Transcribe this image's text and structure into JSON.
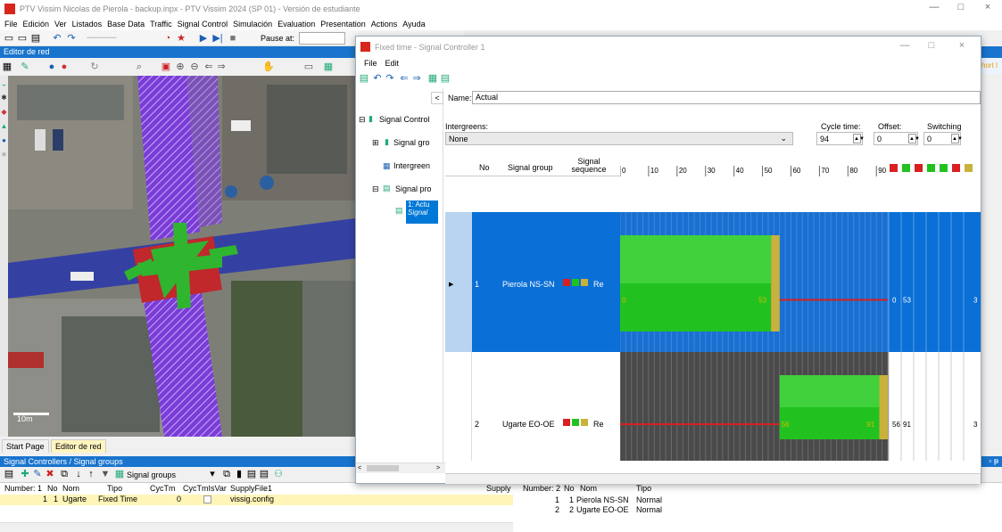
{
  "window": {
    "title": "PTV Vissim Nicolas de Pierola - backup.inpx - PTV Vissim 2024 (SP 01) - Versión de estudiante",
    "minimize": "—",
    "maximize": "□",
    "close": "×"
  },
  "menu": [
    "File",
    "Edición",
    "Ver",
    "Listados",
    "Base Data",
    "Traffic",
    "Signal Control",
    "Simulación",
    "Evaluation",
    "Presentation",
    "Actions",
    "Ayuda"
  ],
  "toolbar": {
    "pause_label": "Pause at:"
  },
  "network_editor": {
    "header": "Editor de red",
    "scale_label": "10m"
  },
  "right_strip": {
    "short_label": "hort I"
  },
  "tabs": {
    "start_page": "Start Page",
    "network_editor": "Editor de red"
  },
  "signal_controllers_panel": {
    "header": "Signal Controllers / Signal groups",
    "dropdown": "Signal groups",
    "list1": {
      "headers": [
        "Number: 1",
        "No",
        "Nom",
        "Tipo",
        "CycTm",
        "CycTmIsVar",
        "SupplyFile1",
        "Supply"
      ],
      "rows": [
        {
          "no": "1",
          "name": "Ugarte",
          "type": "Fixed Time",
          "cyctm": "0",
          "supply": "vissig.config"
        }
      ]
    },
    "list2": {
      "headers": [
        "Number: 2",
        "No",
        "Nom",
        "Tipo"
      ],
      "rows": [
        {
          "idx": "1",
          "no": "1",
          "name": "Pierola NS-SN",
          "type": "Normal"
        },
        {
          "idx": "2",
          "no": "2",
          "name": "Ugarte EO-OE",
          "type": "Normal"
        }
      ]
    }
  },
  "dialog": {
    "title": "Fixed time - Signal Controller 1",
    "menu": [
      "File",
      "Edit"
    ],
    "name_label": "Name:",
    "name_value": "Actual",
    "tree": {
      "root": "Signal Control",
      "signal_groups": "Signal gro",
      "intergreens": "Intergreen",
      "signal_programs": "Signal pro",
      "selected_line1": "1: Actu",
      "selected_line2": "Signal"
    },
    "intergreens_label": "Intergreens:",
    "intergreens_value": "None",
    "cycle_time_label": "Cycle time:",
    "cycle_time_value": "94",
    "offset_label": "Offset:",
    "offset_value": "0",
    "switching_time_label": "Switching time:",
    "switching_time_value": "0",
    "grid": {
      "headers": {
        "no": "No",
        "signal_group": "Signal group",
        "signal_sequence_1": "Signal",
        "signal_sequence_2": "sequence"
      },
      "timeline_ticks": [
        "0",
        "10",
        "20",
        "30",
        "40",
        "50",
        "60",
        "70",
        "80",
        "90"
      ],
      "cycle": 94,
      "rows": [
        {
          "no": "1",
          "name": "Pierola NS-SN",
          "seq": "Re",
          "green_start": 0,
          "green_end": 53,
          "start_label": "0",
          "end_label": "53",
          "col_a": "0",
          "col_b": "53",
          "col_last": "3"
        },
        {
          "no": "2",
          "name": "Ugarte EO-OE",
          "seq": "Re",
          "green_start": 56,
          "green_end": 91,
          "start_label": "56",
          "end_label": "91",
          "col_a": "56",
          "col_b": "91",
          "col_last": "3"
        }
      ]
    }
  },
  "colors": {
    "accent": "#1874cd",
    "selected_row": "#0a6fd6",
    "green": "#21c21f",
    "red_line": "#d82020",
    "amber": "#c8b23c"
  }
}
